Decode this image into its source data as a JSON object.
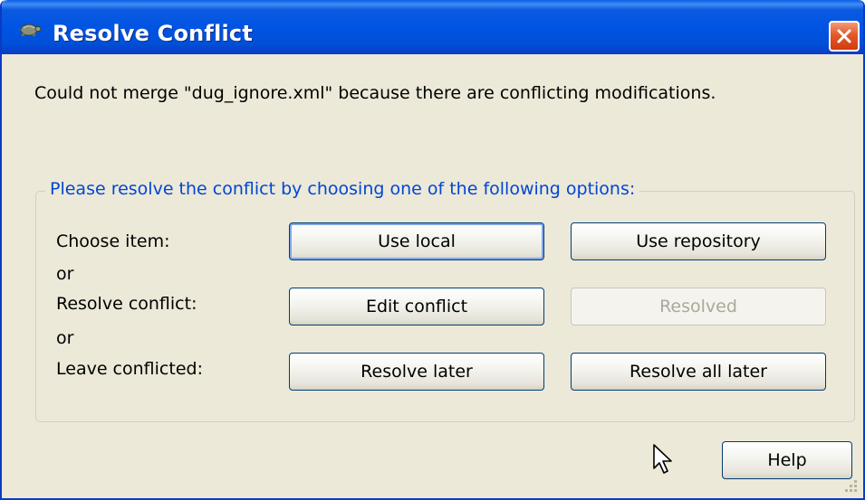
{
  "window": {
    "title": "Resolve Conflict",
    "app_icon": "tortoise-icon",
    "close_icon": "close-icon"
  },
  "message": "Could not merge \"dug_ignore.xml\" because there are conflicting modifications.",
  "group": {
    "legend": "Please resolve the conflict by choosing one of the following options:",
    "rows": {
      "choose_item": "Choose item:",
      "or_1": "or",
      "resolve_conflict": "Resolve conflict:",
      "or_2": "or",
      "leave_conflicted": "Leave conflicted:"
    },
    "buttons": {
      "use_local": "Use local",
      "use_repository": "Use repository",
      "edit_conflict": "Edit conflict",
      "resolved": "Resolved",
      "resolve_later": "Resolve later",
      "resolve_all_later": "Resolve all later"
    }
  },
  "footer": {
    "help": "Help"
  },
  "colors": {
    "title_bar": "#0054e3",
    "dialog_bg": "#ece9d8",
    "legend_text": "#0046d5",
    "close_button": "#e4582b"
  }
}
